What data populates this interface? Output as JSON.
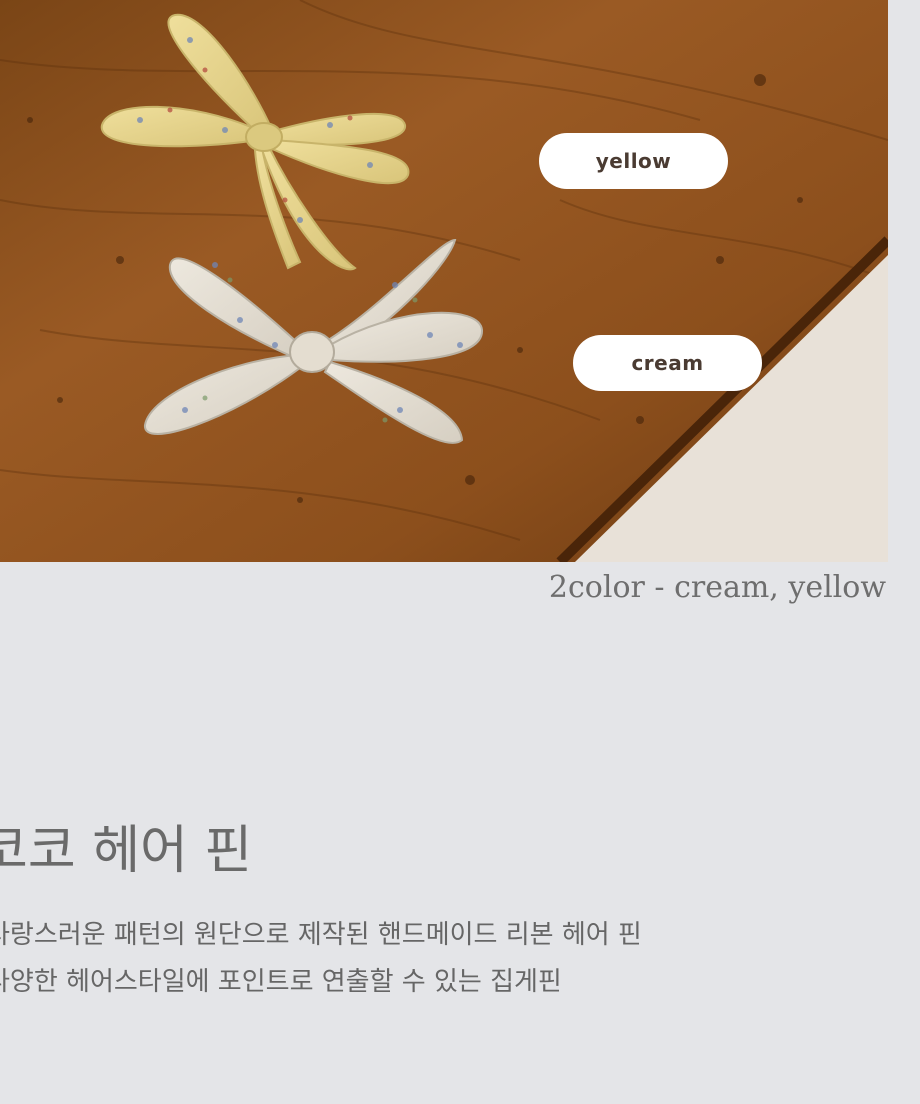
{
  "product": {
    "photo_alt": "",
    "tags": {
      "yellow": "yellow",
      "cream": "cream"
    },
    "caption": "2color - cream, yellow",
    "title": "코코 헤어 핀",
    "description": [
      "사랑스러운 패턴의 원단으로 제작된 핸드메이드 리본 헤어 핀",
      "다양한 헤어스타일에 포인트로 연출할 수 있는 집게핀"
    ]
  },
  "colors": {
    "background": "#e4e5e8",
    "wood": "#8a4f1e",
    "wall": "#e8e1d8",
    "ribbon_yellow": "#e6d48e",
    "ribbon_cream": "#e2ddd2",
    "tag_bg": "#ffffff",
    "tag_text": "#4a3b32",
    "caption_text": "#6e6e6e"
  }
}
